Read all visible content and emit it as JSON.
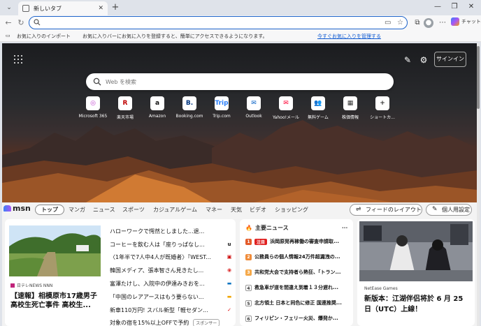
{
  "browser": {
    "tab_title": "新しいタブ",
    "address_value": "",
    "copilot_label": "チャット"
  },
  "favorites_bar": {
    "import_label": "お気に入りのインポート",
    "message": "お気に入りバーにお気に入りを登録すると、簡単にアクセスできるようになります。",
    "link": "今すぐお気に入りを管理する"
  },
  "hero": {
    "signin": "サインイン",
    "search_placeholder": "Web を検索",
    "shortcuts": [
      {
        "label": "Microsoft 365",
        "glyph": "◎",
        "color": "#c34bd1"
      },
      {
        "label": "楽天市場",
        "glyph": "R",
        "color": "#bf0000"
      },
      {
        "label": "Amazon",
        "glyph": "a",
        "color": "#111111"
      },
      {
        "label": "Booking.com",
        "glyph": "B.",
        "color": "#003580"
      },
      {
        "label": "Trip.com",
        "glyph": "Trip",
        "color": "#287dfa"
      },
      {
        "label": "Outlook",
        "glyph": "✉",
        "color": "#0a64c8"
      },
      {
        "label": "Yahoo!メール",
        "glyph": "✉",
        "color": "#ff0033"
      },
      {
        "label": "無料ゲーム",
        "glyph": "👥",
        "color": "#3b6fd8"
      },
      {
        "label": "株価情報",
        "glyph": "▦",
        "color": "#333333"
      },
      {
        "label": "ショートカ...",
        "glyph": "+",
        "color": "#333333"
      }
    ]
  },
  "feed_nav": {
    "brand": "msn",
    "tabs": [
      "トップ",
      "マンガ",
      "ニュース",
      "スポーツ",
      "カジュアルゲーム",
      "マネー",
      "天気",
      "ビデオ",
      "ショッピング"
    ],
    "layout_button": "フィードのレイアウト",
    "personalize_button": "個人用設定"
  },
  "main_story": {
    "source": "日テレNEWS NNN",
    "headline": "【速報】相模原市17歳男子高校生死亡事件 高校生..."
  },
  "headlines": [
    {
      "text": "ハローワークで愕然としました...退...",
      "pub": ""
    },
    {
      "text": "コーヒーを飲む人は「座りっぱなし...",
      "pub": "u"
    },
    {
      "text": "〈1年半で7人中4人が既婚者〉『WEST...",
      "pub": "▣"
    },
    {
      "text": "韓国メディア、張本智さん見きたし...",
      "pub": "◉"
    },
    {
      "text": "富澤たけし、入院中の伊達みきおを...",
      "pub": "▬"
    },
    {
      "text": "「中国のレアアースはもう要らない...",
      "pub": "▬"
    },
    {
      "text": "新車110万円! スバル新型「軽セダン...",
      "pub": "✓"
    },
    {
      "text": "対象の宿を15%以上OFFで予約",
      "pub": "",
      "sponsor": "スポンサー"
    }
  ],
  "trending": {
    "title": "主要ニュース",
    "items": [
      {
        "num": "1",
        "tag": "注目",
        "text": "浜岡原発再稼働の審査申請取..."
      },
      {
        "num": "2",
        "tag": "",
        "text": "公務員らの個人情報24万件超漏洩の..."
      },
      {
        "num": "3",
        "tag": "",
        "text": "共和党大会で支持者ら熱狂、「トラン..."
      },
      {
        "num": "4",
        "tag": "",
        "text": "救急車が道を間違え到着１３分遅れ..."
      },
      {
        "num": "5",
        "tag": "",
        "text": "北方領土 日本と同色に修正 国連推奨..."
      },
      {
        "num": "6",
        "tag": "",
        "text": "フィリピン・フェリー火災、爆発か..."
      }
    ]
  },
  "right_story": {
    "source": "NetEase Games",
    "headline": "新版本：江湖伴侣将於 6 月 25 日（UTC）上線！"
  }
}
